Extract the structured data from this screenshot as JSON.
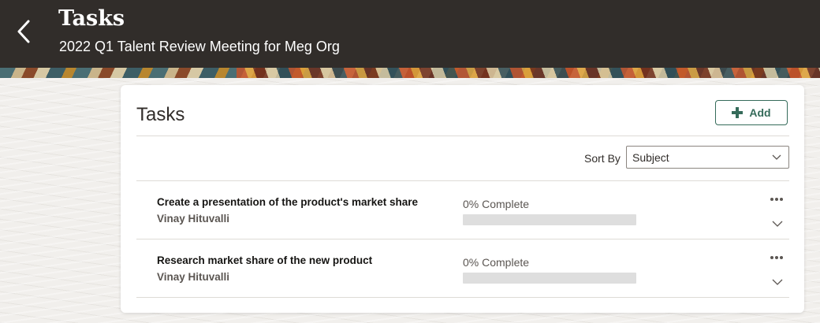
{
  "header": {
    "title": "Tasks",
    "subtitle": "2022 Q1 Talent Review Meeting for Meg Org"
  },
  "card": {
    "title": "Tasks",
    "add_label": "Add",
    "sort_label": "Sort By",
    "sort_value": "Subject"
  },
  "tasks": [
    {
      "title": "Create a presentation of the product's market share",
      "owner": "Vinay Hituvalli",
      "progress_label": "0% Complete",
      "progress": 0
    },
    {
      "title": "Research market share of the new product",
      "owner": "Vinay Hituvalli",
      "progress_label": "0% Complete",
      "progress": 0
    }
  ],
  "colors": {
    "header_bg": "#312d2a",
    "accent": "#356b5a",
    "progress_track": "#dedede"
  }
}
